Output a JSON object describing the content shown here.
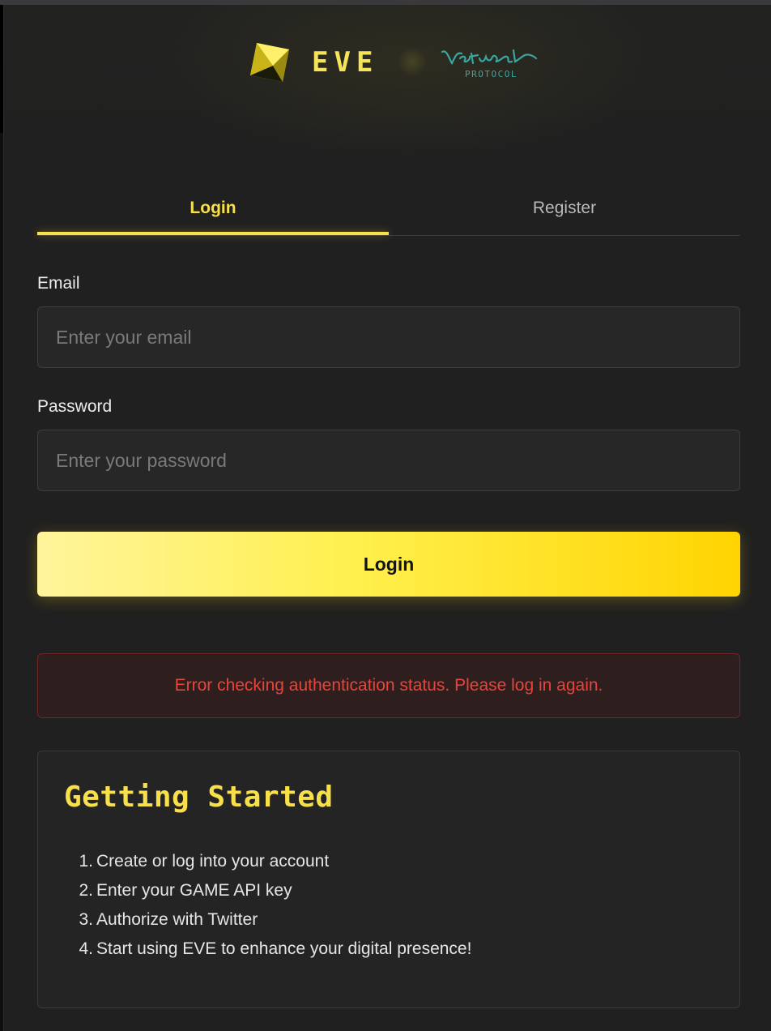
{
  "header": {
    "brand": "EVE",
    "partner_script": "Virtual",
    "partner_subtitle": "PROTOCOL",
    "brand_color": "#f7e04a",
    "partner_color": "#3aa6a0"
  },
  "tabs": [
    {
      "label": "Login",
      "active": true
    },
    {
      "label": "Register",
      "active": false
    }
  ],
  "form": {
    "email_label": "Email",
    "email_placeholder": "Enter your email",
    "email_value": "",
    "password_label": "Password",
    "password_placeholder": "Enter your password",
    "password_value": "",
    "submit_label": "Login"
  },
  "error": {
    "message": "Error checking authentication status. Please log in again.",
    "color": "#e8443a"
  },
  "getting_started": {
    "title": "Getting Started",
    "steps": [
      {
        "num": "1.",
        "text": "Create or log into your account"
      },
      {
        "num": "2.",
        "text": "Enter your GAME API key"
      },
      {
        "num": "3.",
        "text": "Authorize with Twitter"
      },
      {
        "num": "4.",
        "text": "Start using EVE to enhance your digital presence!"
      }
    ]
  }
}
